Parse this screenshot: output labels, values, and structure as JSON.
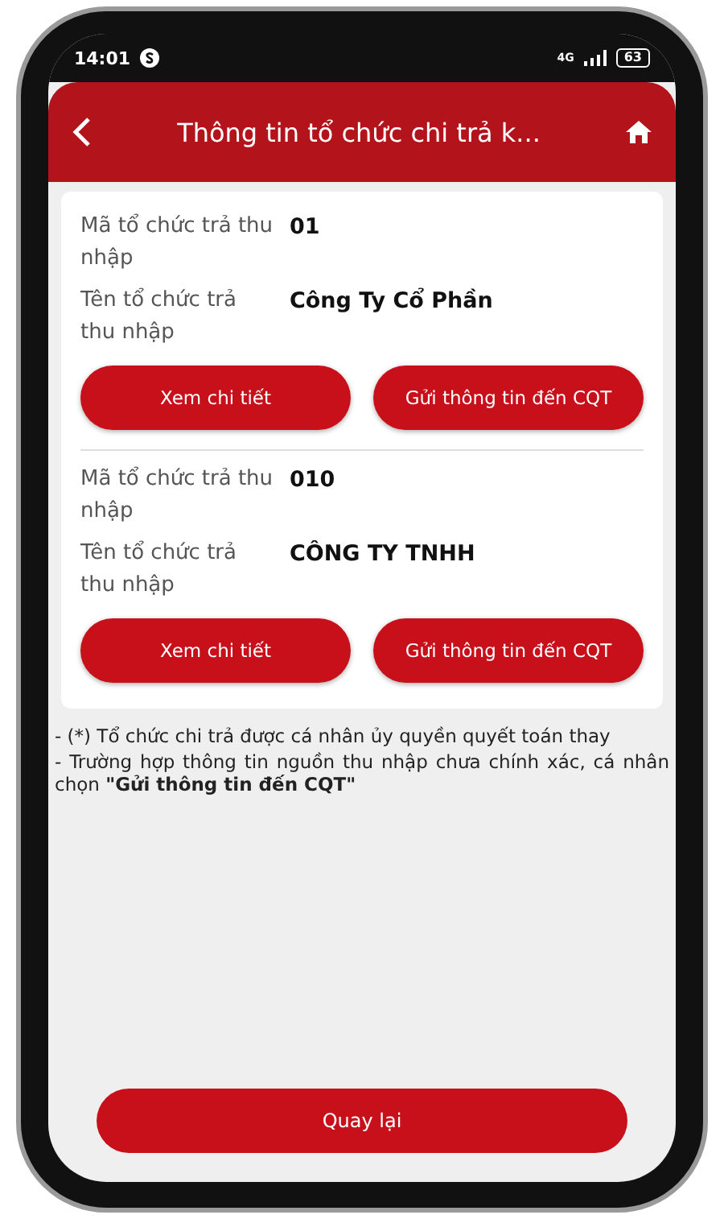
{
  "status_bar": {
    "time": "14:01",
    "network": "4G",
    "battery": "63"
  },
  "header": {
    "title": "Thông tin tổ chức chi trả k..."
  },
  "records": [
    {
      "fields": [
        {
          "label": "Mã tổ chức trả thu nhập",
          "value": "01"
        },
        {
          "label": "Tên tổ chức trả thu nhập",
          "value": "Công Ty Cổ Phần"
        }
      ],
      "buttons": [
        "Xem chi tiết",
        "Gửi thông tin đến CQT"
      ]
    },
    {
      "fields": [
        {
          "label": "Mã tổ chức trả thu nhập",
          "value": "010"
        },
        {
          "label": "Tên tổ chức trả thu nhập",
          "value": "CÔNG TY TNHH"
        }
      ],
      "buttons": [
        "Xem chi tiết",
        "Gửi thông tin đến CQT"
      ]
    }
  ],
  "notes": [
    "- (*) Tổ chức chi trả được cá nhân ủy quyền quyết toán thay",
    "- Trường hợp thông tin nguồn thu nhập chưa chính xác, cá nhân chọn **\"Gửi thông tin đến CQT\"**"
  ],
  "footer_button": "Quay lại"
}
